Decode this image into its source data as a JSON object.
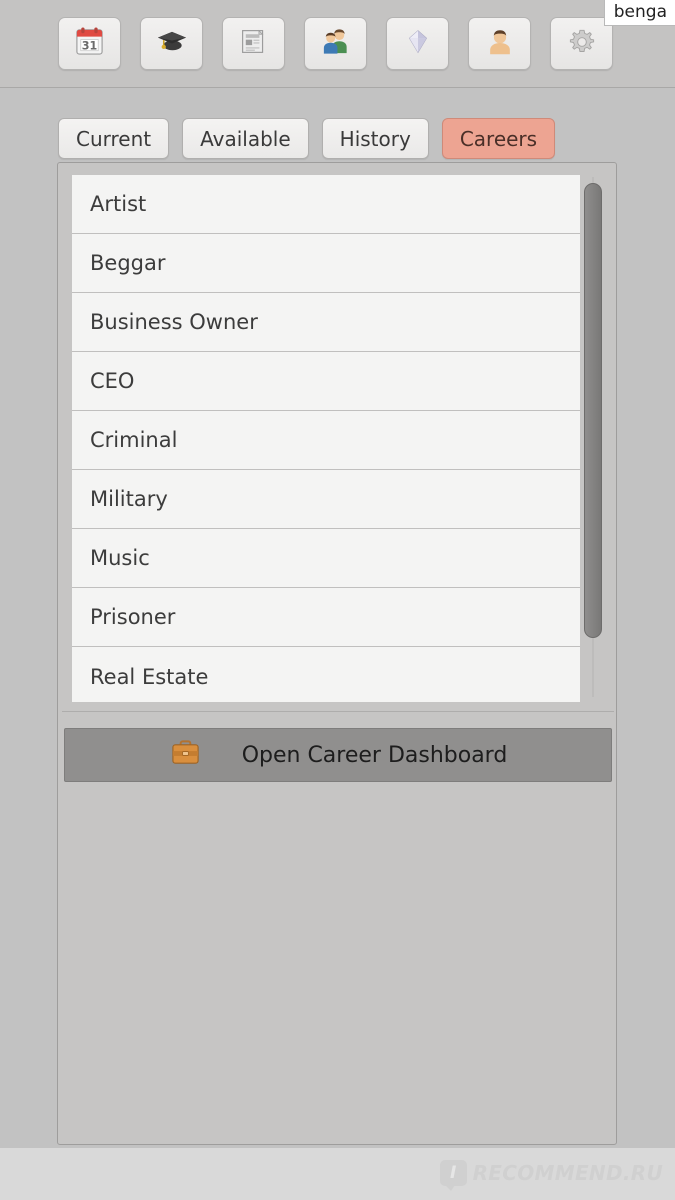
{
  "window": {
    "overlay_label": "benga",
    "background_color": "#c2c2c2"
  },
  "toolbar": {
    "buttons": [
      {
        "icon": "calendar-icon",
        "label": "Calendar",
        "badge": "31"
      },
      {
        "icon": "graduation-cap-icon",
        "label": "Education",
        "badge": ""
      },
      {
        "icon": "newspaper-icon",
        "label": "News",
        "badge": ""
      },
      {
        "icon": "people-icon",
        "label": "Relations",
        "badge": ""
      },
      {
        "icon": "gem-icon",
        "label": "Assets",
        "badge": ""
      },
      {
        "icon": "person-bust-icon",
        "label": "Profile",
        "badge": ""
      },
      {
        "icon": "gear-icon",
        "label": "Settings",
        "badge": ""
      }
    ]
  },
  "tabs": [
    {
      "label": "Current",
      "active": false
    },
    {
      "label": "Available",
      "active": false
    },
    {
      "label": "History",
      "active": false
    },
    {
      "label": "Careers",
      "active": true
    }
  ],
  "careers": {
    "items": [
      {
        "name": "Artist"
      },
      {
        "name": "Beggar"
      },
      {
        "name": "Business Owner"
      },
      {
        "name": "CEO"
      },
      {
        "name": "Criminal"
      },
      {
        "name": "Military"
      },
      {
        "name": "Music"
      },
      {
        "name": "Prisoner"
      },
      {
        "name": "Real Estate"
      }
    ]
  },
  "dashboard_button": {
    "label": "Open Career Dashboard",
    "icon": "briefcase-icon"
  },
  "watermark": {
    "badge_letter": "I",
    "text": "RECOMMEND.RU"
  },
  "colors": {
    "active_tab": "#eda492",
    "panel": "#c6c5c4",
    "row": "#f4f4f3",
    "button": "#908f8e"
  }
}
